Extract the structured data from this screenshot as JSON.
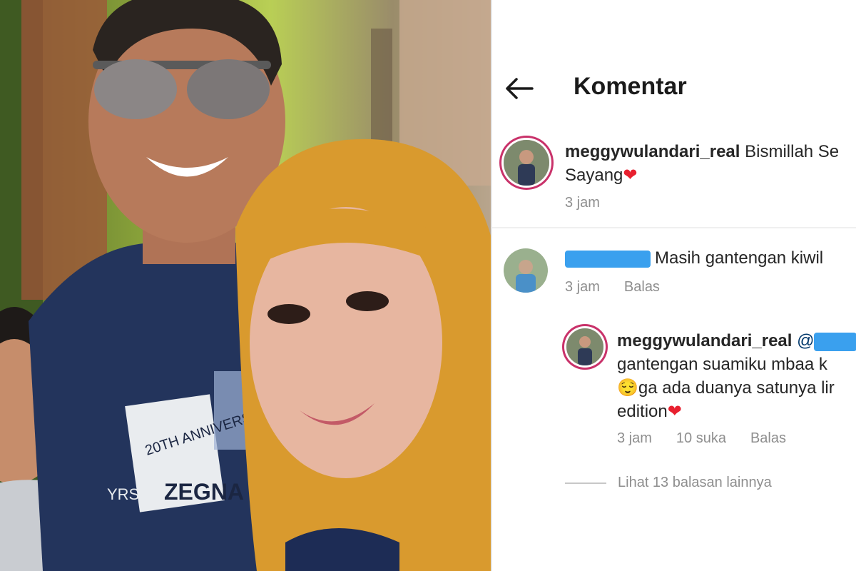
{
  "header": {
    "title": "Komentar",
    "back_icon": "arrow-left-icon"
  },
  "comments": [
    {
      "username": "meggywulandari_real",
      "text_line1": "Bismillah Se",
      "text_line2": "Sayang",
      "emoji": "❤",
      "time": "3 jam"
    },
    {
      "username_hidden": true,
      "text": "Masih gantengan kiwil",
      "time": "3 jam",
      "reply_label": "Balas",
      "replies": [
        {
          "username": "meggywulandari_real",
          "mention_prefix": "@",
          "line2": "gantengan suamiku mbaa k",
          "emoji_smile": "😌",
          "line3": "ga ada duanya satunya lir",
          "line4": "edition",
          "emoji_heart": "❤",
          "time": "3 jam",
          "likes": "10 suka",
          "reply_label": "Balas"
        }
      ],
      "view_more": "Lihat 13 balasan lainnya"
    }
  ],
  "photo": {
    "shirt_text_1": "ZEGNA",
    "shirt_text_2": "20TH ANNIVERSARY",
    "shirt_text_3": "YRS"
  },
  "colors": {
    "story_ring": "#c9326a",
    "heart": "#e8202f",
    "redaction": "#3aa0ee",
    "hijab": "#d99a2e",
    "shirt": "#23345c"
  }
}
